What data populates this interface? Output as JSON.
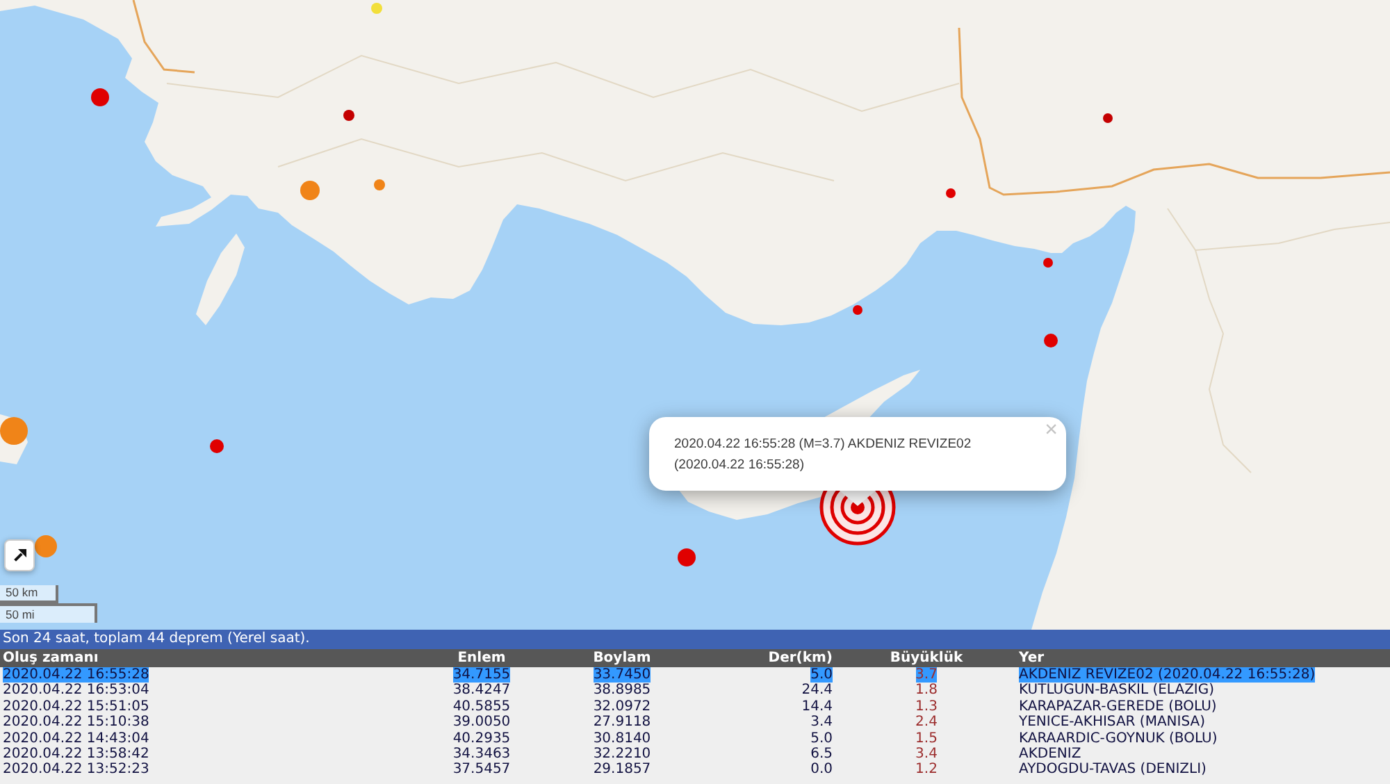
{
  "map": {
    "markers": [
      {
        "color": "#f2df3a",
        "selected": false
      },
      {
        "color": "#e00000",
        "selected": false
      },
      {
        "color": "#c40000",
        "selected": false
      },
      {
        "color": "#c40000",
        "selected": false
      },
      {
        "color": "#f08418",
        "selected": false
      },
      {
        "color": "#f08418",
        "selected": false
      },
      {
        "color": "#e00000",
        "selected": false
      },
      {
        "color": "#e00000",
        "selected": false
      },
      {
        "color": "#e00000",
        "selected": false
      },
      {
        "color": "#e00000",
        "selected": false
      },
      {
        "color": "#f08418",
        "selected": false
      },
      {
        "color": "#e00000",
        "selected": false
      },
      {
        "color": "#e00000",
        "selected": true
      },
      {
        "color": "#f08418",
        "selected": false
      },
      {
        "color": "#e00000",
        "selected": false
      }
    ],
    "popup": {
      "text": "2020.04.22 16:55:28 (M=3.7) AKDENIZ REVIZE02 (2020.04.22 16:55:28)",
      "close": "×"
    },
    "scale": [
      "50 km",
      "50 mi"
    ]
  },
  "table": {
    "caption": "Son 24 saat, toplam 44 deprem (Yerel saat).",
    "columns": [
      "Oluş zamanı",
      "Enlem",
      "Boylam",
      "Der(km)",
      "Büyüklük",
      "Yer"
    ],
    "rows": [
      {
        "cells": [
          "2020.04.22 16:55:28",
          "34.7155",
          "33.7450",
          "5.0",
          "3.7",
          "AKDENIZ REVIZE02 (2020.04.22 16:55:28)"
        ],
        "selected": true
      },
      {
        "cells": [
          "2020.04.22 16:53:04",
          "38.4247",
          "38.8985",
          "24.4",
          "1.8",
          "KUTLUGUN-BASKIL (ELAZIG)"
        ],
        "selected": false
      },
      {
        "cells": [
          "2020.04.22 15:51:05",
          "40.5855",
          "32.0972",
          "14.4",
          "1.3",
          "KARAPAZAR-GEREDE (BOLU)"
        ],
        "selected": false
      },
      {
        "cells": [
          "2020.04.22 15:10:38",
          "39.0050",
          "27.9118",
          "3.4",
          "2.4",
          "YENICE-AKHISAR (MANISA)"
        ],
        "selected": false
      },
      {
        "cells": [
          "2020.04.22 14:43:04",
          "40.2935",
          "30.8140",
          "5.0",
          "1.5",
          "KARAARDIC-GOYNUK (BOLU)"
        ],
        "selected": false
      },
      {
        "cells": [
          "2020.04.22 13:58:42",
          "34.3463",
          "32.2210",
          "6.5",
          "3.4",
          "AKDENIZ"
        ],
        "selected": false
      },
      {
        "cells": [
          "2020.04.22 13:52:23",
          "37.5457",
          "29.1857",
          "0.0",
          "1.2",
          "AYDOGDU-TAVAS (DENIZLI)"
        ],
        "selected": false
      }
    ]
  }
}
